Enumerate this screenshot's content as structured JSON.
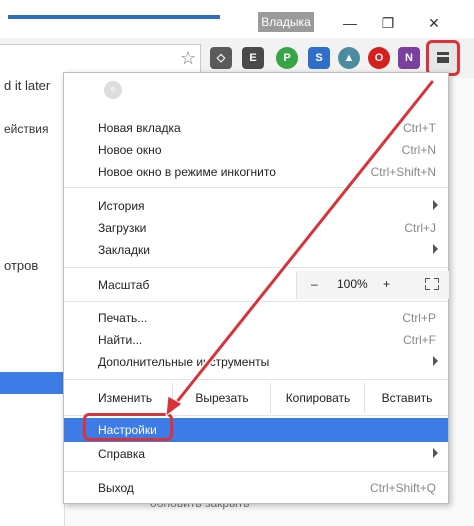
{
  "window": {
    "profile_name": "Владыка",
    "minimize_glyph": "—",
    "restore_glyph": "❐",
    "close_glyph": "✕"
  },
  "toolbar": {
    "star_icon": "☆",
    "extensions": [
      {
        "name": "pocket-icon",
        "glyph": "◇",
        "color": "#5a5a5a"
      },
      {
        "name": "evernote-icon",
        "glyph": "E",
        "color": "#4a4a4a"
      },
      {
        "name": "green-extension-icon",
        "glyph": "P",
        "color": "#35a548"
      },
      {
        "name": "blue-extension-icon",
        "glyph": "S",
        "color": "#2f6fc9"
      },
      {
        "name": "shield-extension-icon",
        "glyph": "▲",
        "color": "#4d8ca0"
      },
      {
        "name": "opera-icon",
        "glyph": "O",
        "color": "#d6201f"
      },
      {
        "name": "onenote-icon",
        "glyph": "N",
        "color": "#7b3fa0"
      }
    ],
    "menu_icon": "menu-icon"
  },
  "page_behind": {
    "tab_text": "d it later",
    "actions_text": "ействия",
    "views_text": "отров",
    "bottom_text": "обновить  закрыть"
  },
  "menu": {
    "new_tab": {
      "label": "Новая вкладка",
      "shortcut": "Ctrl+T"
    },
    "new_window": {
      "label": "Новое окно",
      "shortcut": "Ctrl+N"
    },
    "incognito": {
      "label": "Новое окно в режиме инкогнито",
      "shortcut": "Ctrl+Shift+N"
    },
    "history": {
      "label": "История"
    },
    "downloads": {
      "label": "Загрузки",
      "shortcut": "Ctrl+J"
    },
    "bookmarks": {
      "label": "Закладки"
    },
    "zoom": {
      "label": "Масштаб",
      "minus": "–",
      "value": "100%",
      "plus": "+"
    },
    "print": {
      "label": "Печать...",
      "shortcut": "Ctrl+P"
    },
    "find": {
      "label": "Найти...",
      "shortcut": "Ctrl+F"
    },
    "more_tools": {
      "label": "Дополнительные инструменты"
    },
    "edit": {
      "label": "Изменить",
      "cut": "Вырезать",
      "copy": "Копировать",
      "paste": "Вставить"
    },
    "settings": {
      "label": "Настройки"
    },
    "help": {
      "label": "Справка"
    },
    "exit": {
      "label": "Выход",
      "shortcut": "Ctrl+Shift+Q"
    }
  },
  "colors": {
    "highlight": "#3d7be6",
    "annotation": "#d9333a"
  }
}
